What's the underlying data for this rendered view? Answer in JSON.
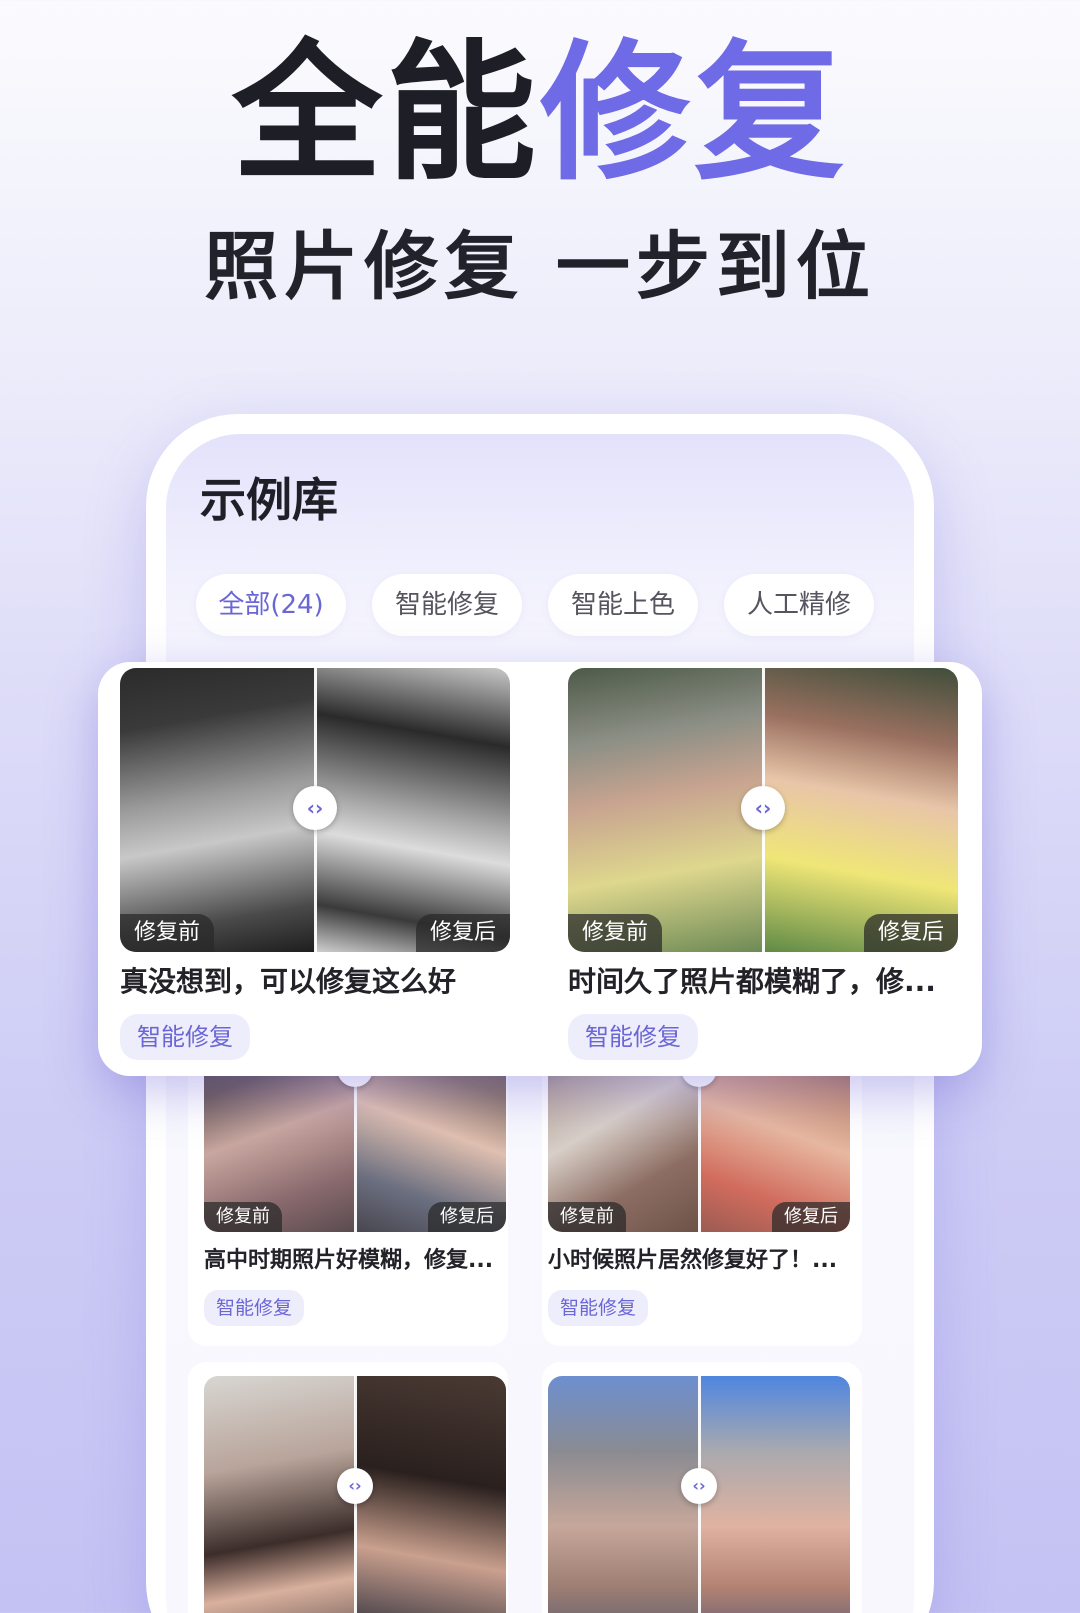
{
  "hero": {
    "title_dark": "全能",
    "title_accent": "修复",
    "subtitle": "照片修复 一步到位"
  },
  "screen": {
    "title": "示例库",
    "tabs": [
      "全部(24)",
      "智能修复",
      "智能上色",
      "人工精修"
    ]
  },
  "labels": {
    "before": "修复前",
    "after": "修复后",
    "compare_handle": "‹›"
  },
  "featured_cards": [
    {
      "caption": "真没想到，可以修复这么好",
      "chip": "智能修复"
    },
    {
      "caption": "时间久了照片都模糊了，修...",
      "chip": "智能修复"
    }
  ],
  "grid_cards": [
    {
      "caption": "高中时期照片好模糊，修复...",
      "chip": "智能修复"
    },
    {
      "caption": "小时候照片居然修复好了！...",
      "chip": "智能修复"
    },
    {
      "caption": "",
      "chip": ""
    },
    {
      "caption": "",
      "chip": ""
    }
  ],
  "colors": {
    "accent": "#6f6ae6",
    "text_dark": "#1e1e26",
    "chip_bg": "#eeedfb",
    "chip_text": "#6a66d6"
  }
}
